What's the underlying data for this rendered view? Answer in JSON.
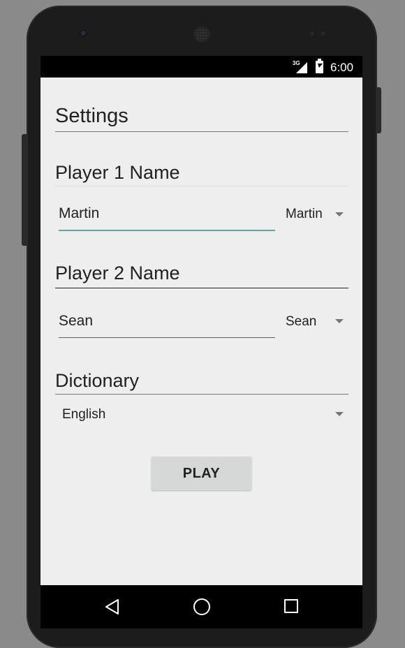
{
  "status_bar": {
    "network_label": "3G",
    "time": "6:00",
    "icons": [
      "signal-icon",
      "battery-charging-icon"
    ]
  },
  "settings": {
    "title": "Settings"
  },
  "player1": {
    "label": "Player 1 Name",
    "input_value": "Martin",
    "spinner_selected": "Martin"
  },
  "player2": {
    "label": "Player 2 Name",
    "input_value": "Sean",
    "spinner_selected": "Sean"
  },
  "dictionary": {
    "label": "Dictionary",
    "spinner_selected": "English"
  },
  "actions": {
    "play_label": "PLAY"
  },
  "nav_bar": {
    "icons": [
      "back-icon",
      "home-icon",
      "recents-icon"
    ]
  },
  "colors": {
    "accent": "#5da7a0",
    "screen_background": "#eeeeee",
    "button_background": "#d6d7d7",
    "status_bar": "#000000"
  }
}
